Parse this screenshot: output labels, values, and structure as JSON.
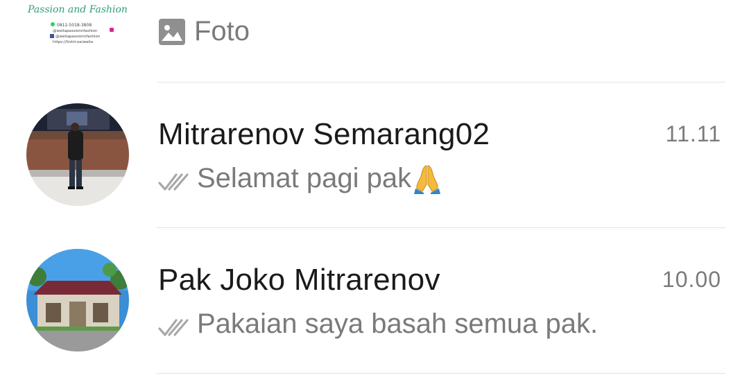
{
  "chats": [
    {
      "name": "",
      "avatar_text": {
        "line1": "Passion and Fashion",
        "phone": "0812-5018-3808",
        "instagram": "@weliapassionnfashion",
        "facebook": "@weliapassionnfashion",
        "link": "https://linktr.ee/welia"
      },
      "preview_icon": "photo-icon",
      "preview": "Foto",
      "time": ""
    },
    {
      "name": "Mitrarenov Semarang02",
      "time": "11.11",
      "status_icon": "double-check-icon",
      "preview": "Selamat pagi pak",
      "preview_emoji": "folded-hands-icon"
    },
    {
      "name": "Pak Joko Mitrarenov",
      "time": "10.00",
      "status_icon": "double-check-icon",
      "preview": "Pakaian saya basah semua pak."
    }
  ],
  "colors": {
    "name": "#1a1a1a",
    "secondary": "#7a7a7a",
    "divider": "#e3e3e3",
    "logo_green": "#2e9e7a"
  }
}
